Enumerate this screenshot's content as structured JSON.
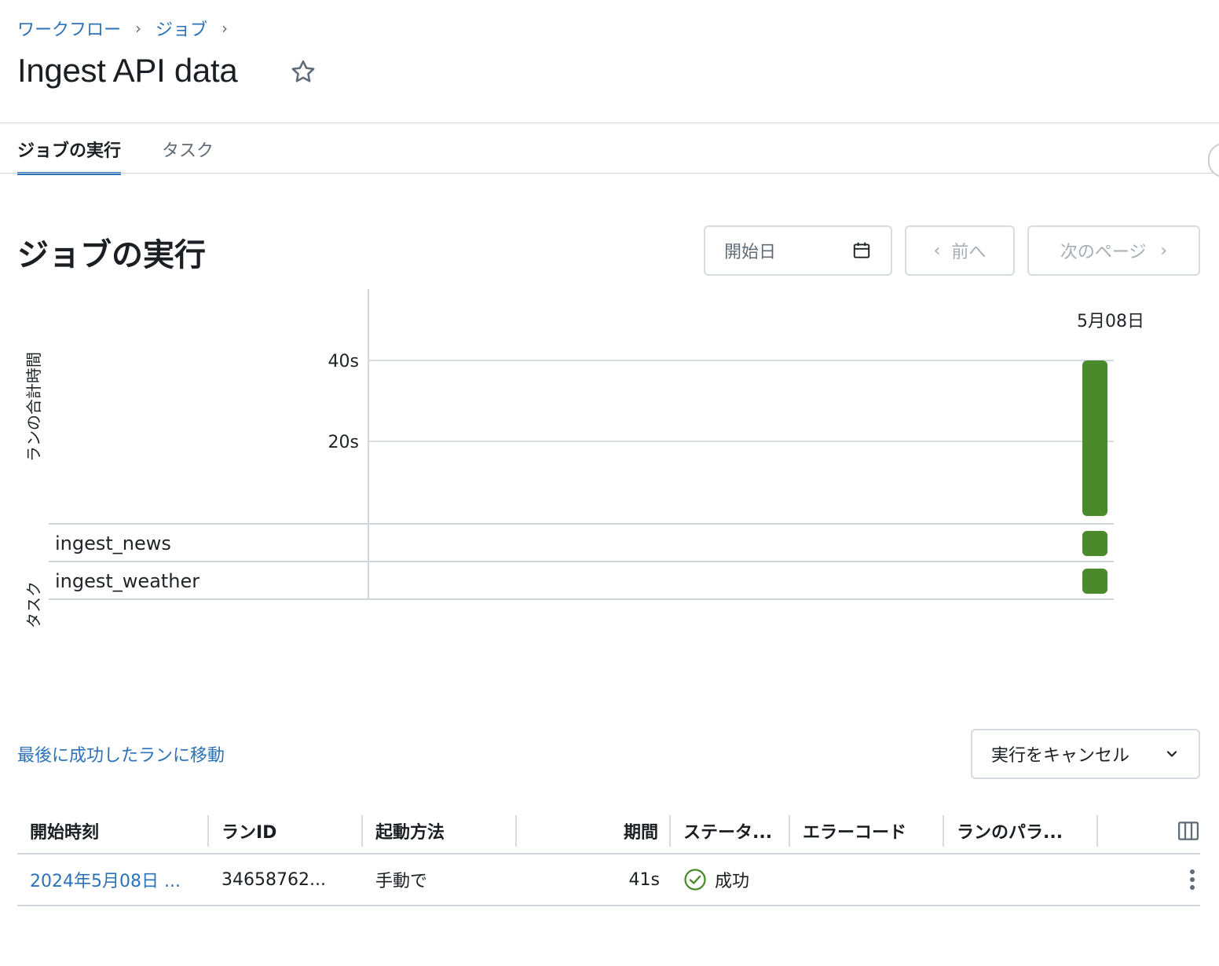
{
  "breadcrumb": {
    "items": [
      "ワークフロー",
      "ジョブ"
    ],
    "separator": "›"
  },
  "page": {
    "title": "Ingest API data"
  },
  "tabs": [
    {
      "label": "ジョブの実行",
      "active": true
    },
    {
      "label": "タスク",
      "active": false
    }
  ],
  "section": {
    "title": "ジョブの実行"
  },
  "controls": {
    "date_placeholder": "開始日",
    "prev_label": "前へ",
    "next_label": "次のページ"
  },
  "chart_data": {
    "type": "bar",
    "categories": [
      "5月08日"
    ],
    "values": [
      41
    ],
    "ylabel": "ランの合計時間",
    "y_ticks": [
      "20s",
      "40s"
    ],
    "ylim": [
      0,
      40
    ],
    "grid": true,
    "task_axis_label": "タスク",
    "tasks": [
      {
        "name": "ingest_news",
        "status": "success"
      },
      {
        "name": "ingest_weather",
        "status": "success"
      }
    ],
    "bar_color": "#4a8a2b"
  },
  "actions": {
    "last_success_link": "最後に成功したランに移動",
    "cancel_runs": "実行をキャンセル"
  },
  "table": {
    "columns": [
      "開始時刻",
      "ランID",
      "起動方法",
      "期間",
      "ステータ...",
      "エラーコード",
      "ランのパラ..."
    ],
    "rows": [
      {
        "start_time": "2024年5月08日 ...",
        "run_id": "34658762...",
        "trigger": "手動で",
        "duration": "41s",
        "status": "成功",
        "error_code": "",
        "params": ""
      }
    ]
  },
  "colors": {
    "accent": "#2b72b8",
    "success": "#4a8a2b"
  }
}
